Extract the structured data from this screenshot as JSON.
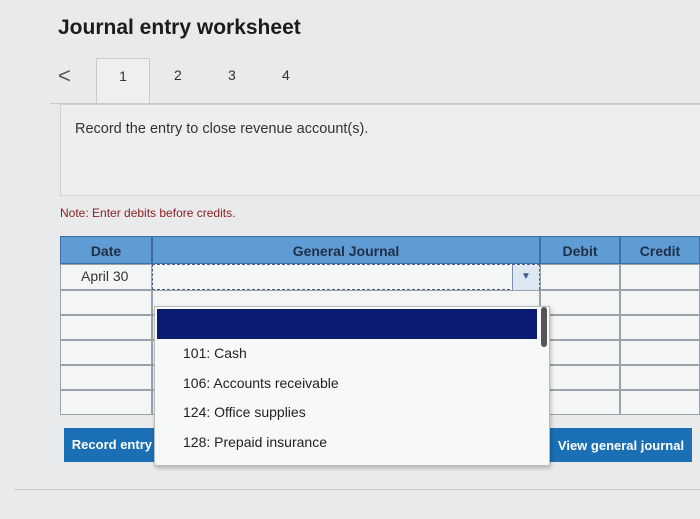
{
  "header": {
    "title": "Journal entry worksheet"
  },
  "tabs": {
    "prev_icon": "<",
    "items": [
      "1",
      "2",
      "3",
      "4"
    ],
    "active_index": 0
  },
  "instruction": {
    "text": "Record the entry to close revenue account(s)."
  },
  "note": {
    "text": "Note: Enter debits before credits."
  },
  "journal": {
    "columns": {
      "date": "Date",
      "account": "General Journal",
      "debit": "Debit",
      "credit": "Credit"
    },
    "rows": [
      {
        "date": "April 30",
        "account": "",
        "debit": "",
        "credit": ""
      },
      {
        "date": "",
        "account": "",
        "debit": "",
        "credit": ""
      },
      {
        "date": "",
        "account": "",
        "debit": "",
        "credit": ""
      },
      {
        "date": "",
        "account": "",
        "debit": "",
        "credit": ""
      },
      {
        "date": "",
        "account": "",
        "debit": "",
        "credit": ""
      },
      {
        "date": "",
        "account": "",
        "debit": "",
        "credit": ""
      }
    ]
  },
  "dropdown": {
    "options": [
      "101: Cash",
      "106: Accounts receivable",
      "124: Office supplies",
      "128: Prepaid insurance"
    ]
  },
  "buttons": {
    "record_label": "Record entry",
    "view_label": "View general journal"
  },
  "colors": {
    "header_blue": "#5f9bd5",
    "button_blue": "#1a6fb5",
    "selected_navy": "#0b1a72"
  }
}
